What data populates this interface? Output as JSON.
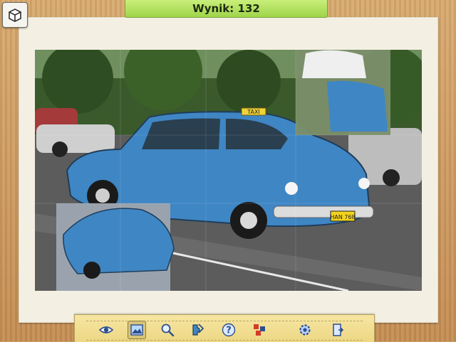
{
  "score": {
    "label": "Wynik:",
    "value": "132"
  },
  "menu": {
    "icon": "box-menu-icon"
  },
  "puzzle": {
    "picture": "blue vintage taxi car on street",
    "taxi_sign": "TAXI",
    "plate": "HAN 768"
  },
  "toolbar": {
    "tools": [
      {
        "icon": "eye-icon"
      },
      {
        "icon": "preview-picture-icon",
        "active": true
      },
      {
        "icon": "magnifier-icon"
      },
      {
        "icon": "edge-pieces-icon"
      },
      {
        "icon": "question-icon"
      },
      {
        "icon": "shuffle-pieces-icon"
      },
      {
        "icon": "gear-icon"
      },
      {
        "icon": "exit-door-icon"
      }
    ]
  },
  "colors": {
    "banner": "#b5e35d",
    "toolbar": "#efdb8b",
    "paper": "#f3f0e3",
    "car": "#3f86c4"
  }
}
